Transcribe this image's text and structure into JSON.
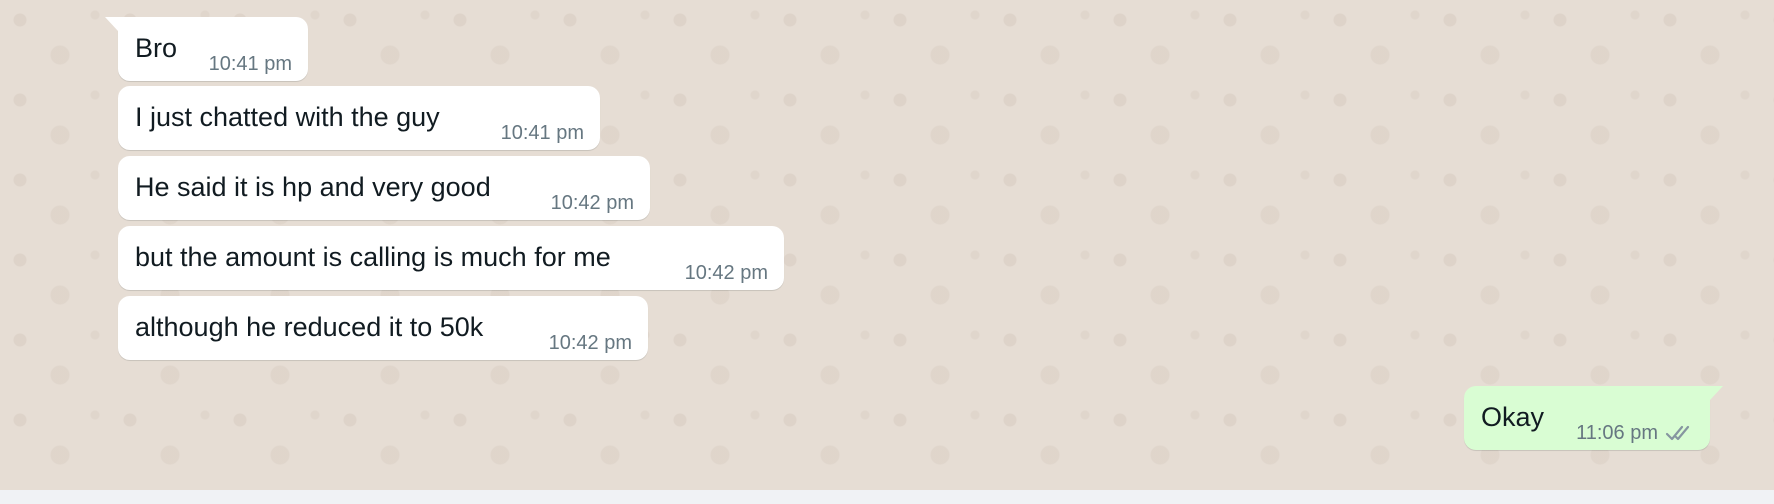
{
  "messages": [
    {
      "text": "Bro",
      "time": "10:41 pm",
      "direction": "incoming"
    },
    {
      "text": "I just chatted with the guy",
      "time": "10:41 pm",
      "direction": "incoming"
    },
    {
      "text": "He said it is hp and very good",
      "time": "10:42 pm",
      "direction": "incoming"
    },
    {
      "text": "but the amount is calling is much for me",
      "time": "10:42 pm",
      "direction": "incoming"
    },
    {
      "text": "although he reduced it to 50k",
      "time": "10:42 pm",
      "direction": "incoming"
    },
    {
      "text": "Okay",
      "time": "11:06 pm",
      "direction": "outgoing",
      "status": "delivered-double-check"
    }
  ],
  "colors": {
    "incoming_bubble": "#ffffff",
    "outgoing_bubble": "#d9fdd3",
    "chat_background": "#e6ddd4",
    "timestamp": "#667781",
    "ticks": "#8696a0"
  }
}
